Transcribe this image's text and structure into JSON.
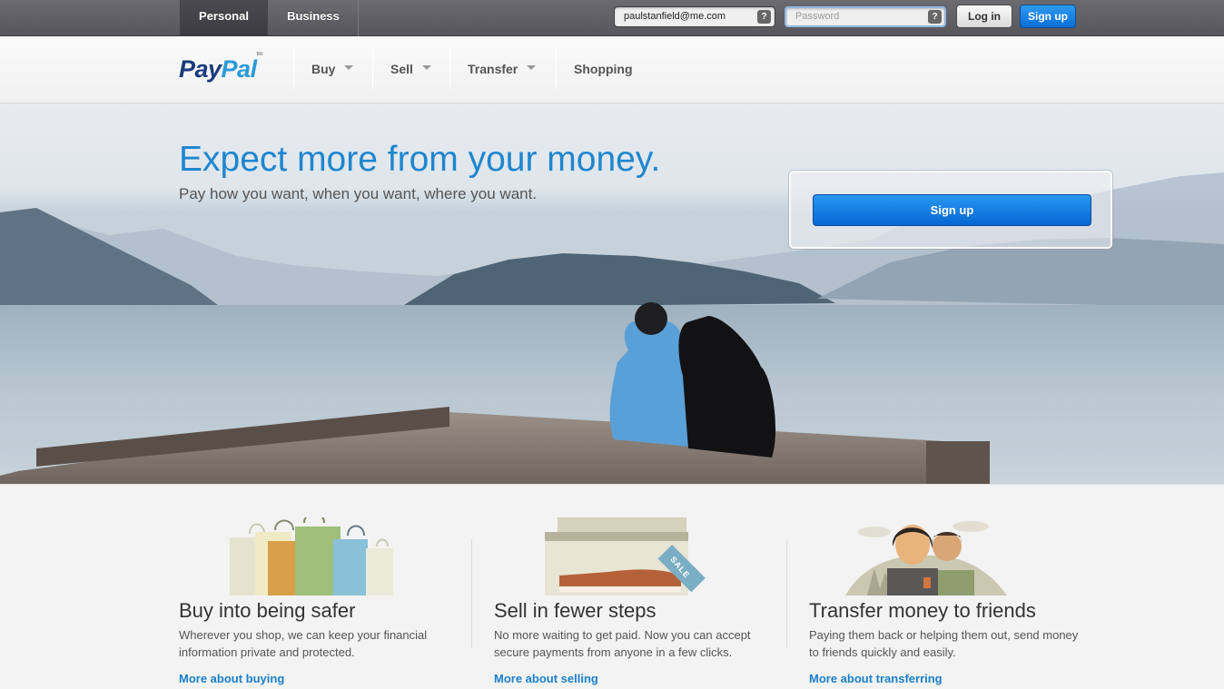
{
  "topbar": {
    "tabs": [
      {
        "label": "Personal",
        "active": true
      },
      {
        "label": "Business",
        "active": false
      }
    ],
    "email_value": "paulstanfield@me.com",
    "password_placeholder": "Password",
    "help_glyph": "?",
    "login_label": "Log in",
    "signup_label": "Sign up"
  },
  "nav": {
    "logo_pay": "Pay",
    "logo_pal": "Pal",
    "logo_tm": "tm",
    "items": [
      {
        "label": "Buy",
        "has_dropdown": true
      },
      {
        "label": "Sell",
        "has_dropdown": true
      },
      {
        "label": "Transfer",
        "has_dropdown": true
      },
      {
        "label": "Shopping",
        "has_dropdown": false
      }
    ]
  },
  "hero": {
    "title": "Expect more from your money.",
    "subtitle": "Pay how you want, when you want, where you want.",
    "signup_label": "Sign up"
  },
  "features": [
    {
      "icon": "shopping-bags-icon",
      "title": "Buy into being safer",
      "desc": "Wherever you shop, we can keep your financial information private and protected.",
      "link": "More about buying"
    },
    {
      "icon": "shoe-sale-icon",
      "title": "Sell in fewer steps",
      "desc": "No more waiting to get paid. Now you can accept secure payments from anyone in a few clicks.",
      "link": "More about selling",
      "tag_text": "SALE"
    },
    {
      "icon": "friends-icon",
      "title": "Transfer money to friends",
      "desc": "Paying them back or helping them out, send money to friends quickly and easily.",
      "link": "More about transferring"
    }
  ],
  "colors": {
    "brand_dark": "#193b7c",
    "brand_light": "#2a9ad9",
    "accent": "#1a7fc8",
    "button_blue": "#0a6dd4"
  }
}
